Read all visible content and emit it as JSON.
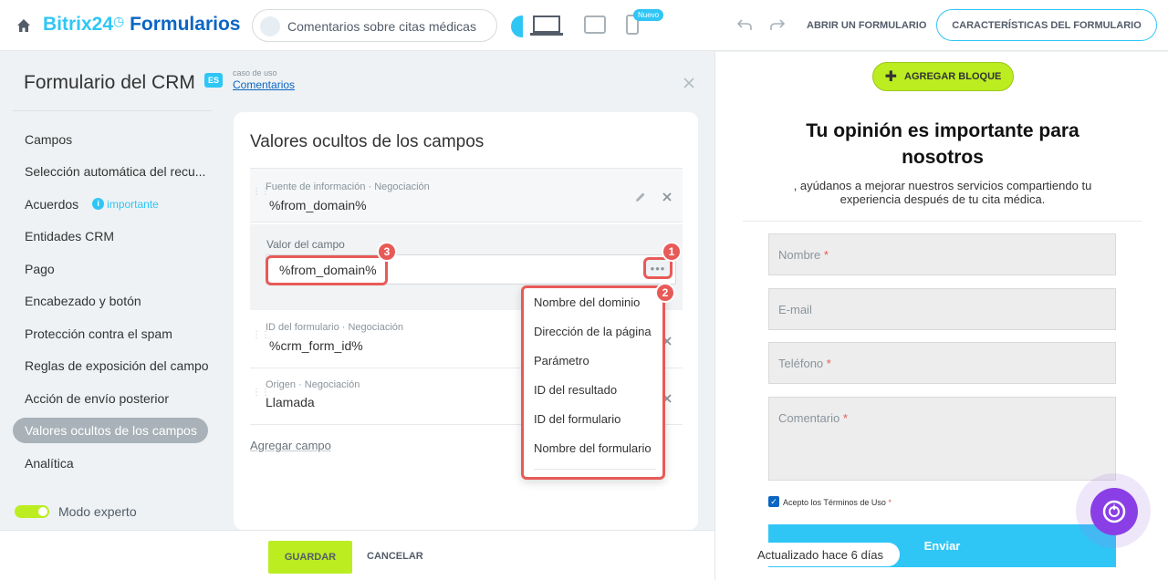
{
  "header": {
    "brand_primary": "Bitrix24",
    "brand_secondary": "Formularios",
    "form_selector": "Comentarios sobre citas médicas",
    "new_badge": "Nuevo",
    "open_form_link": "ABRIR UN FORMULARIO",
    "features_button": "CARACTERÍSTICAS DEL FORMULARIO"
  },
  "left_panel": {
    "title": "Formulario del CRM",
    "use_case_label": "caso de uso",
    "use_case_link": "Comentarios",
    "nav_items": [
      {
        "label": "Campos"
      },
      {
        "label": "Selección automática del recu..."
      },
      {
        "label": "Acuerdos",
        "badge": "importante"
      },
      {
        "label": "Entidades CRM"
      },
      {
        "label": "Pago"
      },
      {
        "label": "Encabezado y botón"
      },
      {
        "label": "Protección contra el spam"
      },
      {
        "label": "Reglas de exposición del campo"
      },
      {
        "label": "Acción de envío posterior"
      },
      {
        "label": "Valores ocultos de los campos",
        "active": true
      },
      {
        "label": "Analítica"
      }
    ],
    "expert_mode_label": "Modo experto"
  },
  "card": {
    "title": "Valores ocultos de los campos",
    "rows": [
      {
        "label": "Fuente de información · Negociación",
        "value": "%from_domain%"
      },
      {
        "label": "ID del formulario · Negociación",
        "value": "%crm_form_id%"
      },
      {
        "label": "Origen · Negociación",
        "value": "Llamada"
      }
    ],
    "edit_label": "Valor del campo",
    "edit_value": "%from_domain%",
    "dots": "•••",
    "add_field": "Agregar campo"
  },
  "dropdown": {
    "items": [
      "Nombre del dominio",
      "Dirección de la página",
      "Parámetro",
      "ID del resultado",
      "ID del formulario",
      "Nombre del formulario"
    ]
  },
  "markers": [
    "1",
    "2",
    "3"
  ],
  "footer": {
    "save": "GUARDAR",
    "cancel": "CANCELAR",
    "updated": "Actualizado hace 6 días"
  },
  "preview": {
    "add_block": "AGREGAR BLOQUE",
    "title": "Tu opinión es importante para nosotros",
    "subtitle": ", ayúdanos a mejorar nuestros servicios compartiendo tu experiencia después de tu cita médica.",
    "fields": [
      {
        "placeholder": "Nombre",
        "required": true
      },
      {
        "placeholder": "E-mail",
        "required": false
      },
      {
        "placeholder": "Teléfono",
        "required": true
      },
      {
        "placeholder": "Comentario",
        "required": true
      }
    ],
    "terms": "Acepto los Términos de Uso",
    "send": "Enviar"
  },
  "colors": {
    "accent": "#2fc6f6",
    "brand_dark": "#0b66c3",
    "green": "#bbed21",
    "annotation": "#e85a57"
  }
}
